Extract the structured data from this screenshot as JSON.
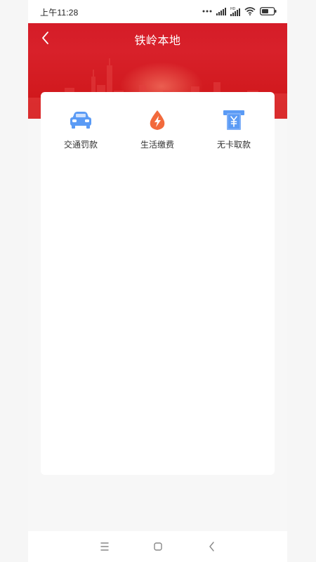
{
  "status_bar": {
    "time": "上午11:28",
    "icons": [
      "dots-icon",
      "signal-icon",
      "hd-icon",
      "signal-icon",
      "wifi-icon",
      "battery-icon"
    ],
    "hd_label": "HD"
  },
  "header": {
    "title": "铁岭本地",
    "back_icon": "chevron-left-icon",
    "colors": {
      "primary": "#d51c28"
    }
  },
  "services": [
    {
      "label": "交通罚款",
      "icon": "car-icon",
      "color": "#5b9bf5"
    },
    {
      "label": "生活缴费",
      "icon": "flame-bolt-icon",
      "color": "#f26a3c"
    },
    {
      "label": "无卡取款",
      "icon": "atm-yuan-icon",
      "color": "#5b9bf5"
    }
  ],
  "navigation_bar": {
    "buttons": [
      "menu-icon",
      "home-square-icon",
      "back-chevron-icon"
    ]
  }
}
